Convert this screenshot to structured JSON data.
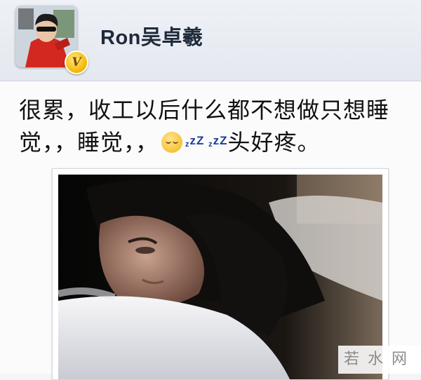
{
  "profile": {
    "username": "Ron吴卓羲",
    "verified_badge": "V"
  },
  "post": {
    "text_main": "很累，收工以后什么都不想做只想睡觉，，睡觉，，",
    "emoji_icon": "sleepy-face-icon",
    "zzz_1_small": "z",
    "zzz_1_big": "zZ",
    "zzz_2_small": "z",
    "zzz_2_big": "zZ",
    "text_tail": "头好疼。",
    "photo": "sleeping-woman-photo"
  },
  "watermark": {
    "text": "若水网"
  }
}
